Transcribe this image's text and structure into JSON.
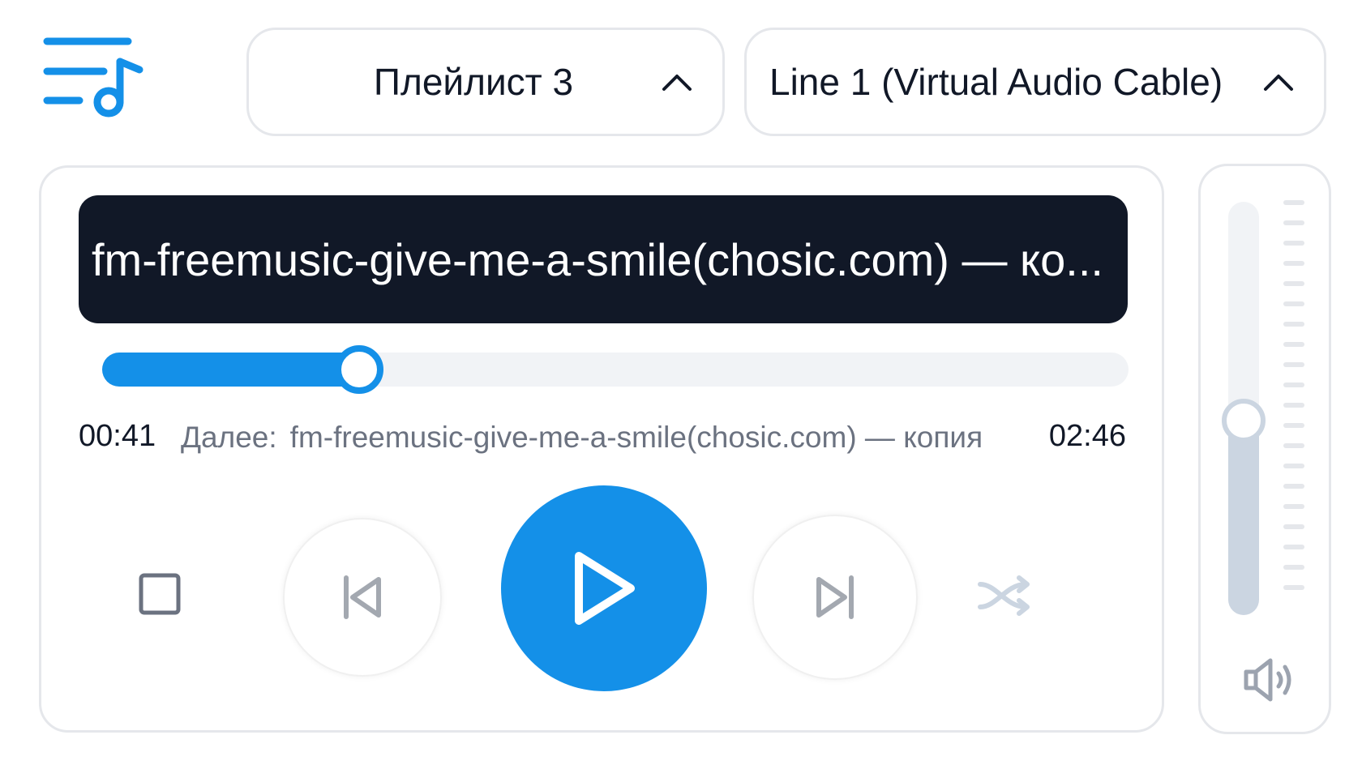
{
  "header": {
    "playlist_select": {
      "value": "Плейлист 3",
      "icon": "chevron-up-icon"
    },
    "device_select": {
      "value": "Line 1 (Virtual Audio Cable)",
      "icon": "chevron-up-icon"
    },
    "playlist_icon": "playlist-music-icon"
  },
  "player": {
    "track_title": "fm-freemusic-give-me-a-smile(chosic.com) — ко...",
    "current_time": "00:41",
    "total_time": "02:46",
    "progress_fraction": 0.25,
    "next_prefix": "Далее:",
    "next_track": "fm-freemusic-give-me-a-smile(chosic.com) — копия",
    "controls": {
      "stop_icon": "stop-icon",
      "prev_icon": "skip-previous-icon",
      "play_icon": "play-icon",
      "next_icon": "skip-next-icon",
      "shuffle_icon": "shuffle-icon"
    }
  },
  "volume": {
    "level_fraction": 0.47,
    "icon": "speaker-volume-icon"
  },
  "colors": {
    "accent": "#1490e8",
    "banner_bg": "#111827",
    "muted": "#cbd5e1"
  }
}
